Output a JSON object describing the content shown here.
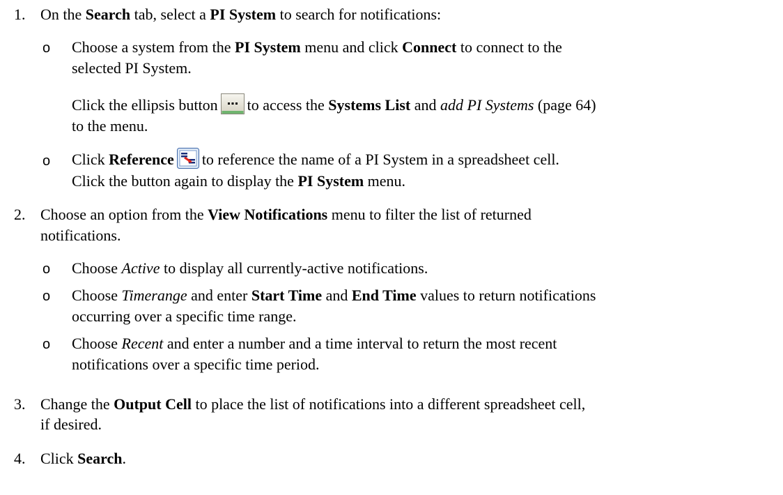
{
  "steps": [
    {
      "number": "1.",
      "line1": [
        "On the ",
        "Search",
        " tab, select a ",
        "PI System",
        " to search for notifications:"
      ],
      "bullets": [
        {
          "symbol": "o",
          "lines": [
            [
              "Choose a system from the ",
              "PI System",
              " menu and click ",
              "Connect",
              " to connect to the"
            ],
            [
              "selected PI System."
            ]
          ]
        },
        {
          "para": {
            "a": "Click the ellipsis button",
            "b": "to access the ",
            "c": "Systems List",
            "d": " and ",
            "e": "add PI Systems",
            "f": " (page 64)",
            "g": "to the menu."
          }
        },
        {
          "symbol": "o",
          "ref": {
            "a": "Click ",
            "b": "Reference",
            "c": "to reference the name of a PI System in a spreadsheet cell.",
            "d": "Click the button again to display the ",
            "e": "PI System",
            "f": " menu."
          }
        }
      ]
    },
    {
      "number": "2.",
      "line1": [
        "Choose an option from the ",
        "View Notifications",
        " menu to filter the list of returned"
      ],
      "line2": "notifications.",
      "bullets": [
        {
          "symbol": "o",
          "a": "Choose ",
          "b": "Active",
          "c": " to display all currently-active notifications."
        },
        {
          "symbol": "o",
          "a": "Choose ",
          "b": "Timerange",
          "c": " and enter ",
          "d": "Start Time",
          "e": " and ",
          "f": "End Time",
          "g": " values to return notifications",
          "h": "occurring over a specific time range."
        },
        {
          "symbol": "o",
          "a": "Choose ",
          "b": "Recent",
          "c": " and enter a number and a time interval to return the most recent",
          "d": "notifications over a specific time period."
        }
      ]
    },
    {
      "number": "3.",
      "line1": [
        "Change the ",
        "Output Cell",
        " to place the list of notifications into a different spreadsheet cell,"
      ],
      "line2": "if desired."
    },
    {
      "number": "4.",
      "line1": [
        "Click ",
        "Search",
        "."
      ]
    }
  ],
  "icons": {
    "ellipsis": "ellipsis-button-icon",
    "reference": "reference-icon"
  }
}
